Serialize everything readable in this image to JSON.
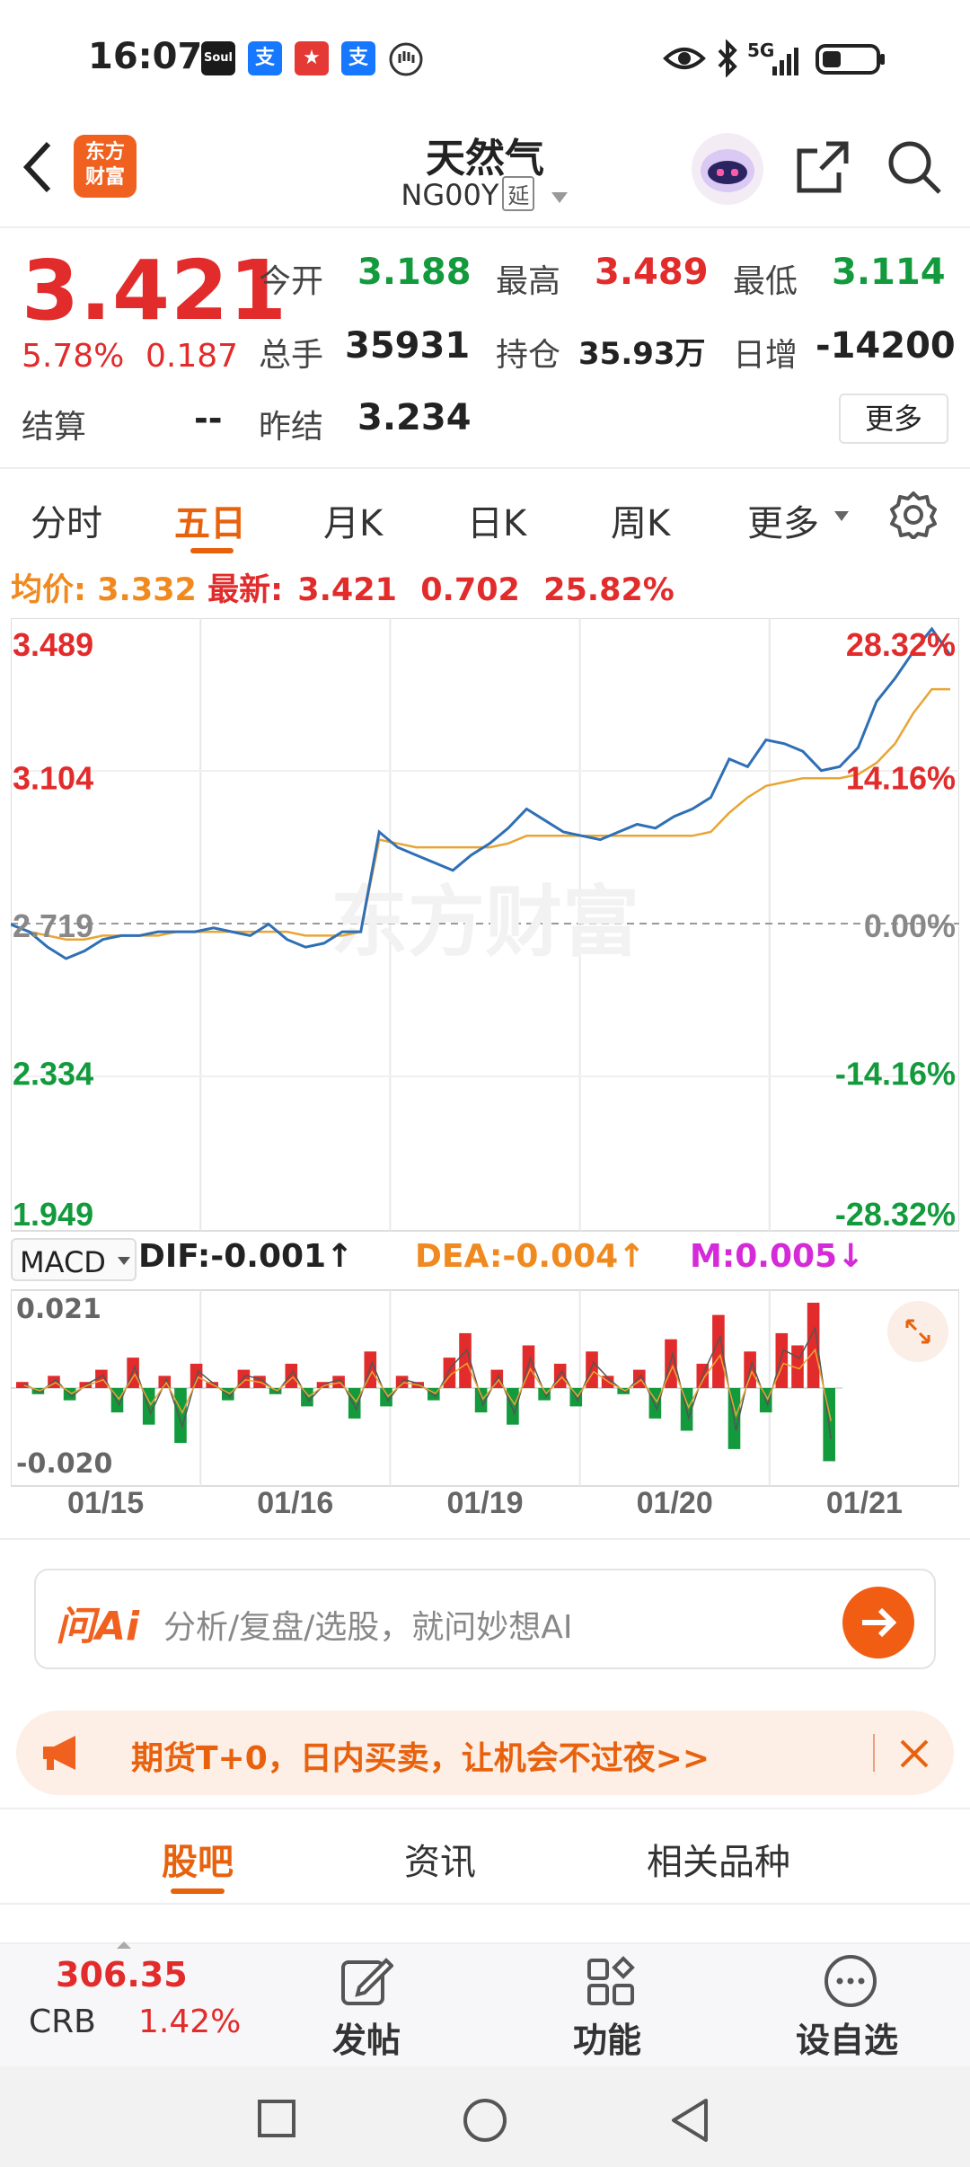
{
  "status_bar": {
    "time": "16:07",
    "apps": [
      {
        "name": "soul-app-icon",
        "text": "Soul",
        "color": "#1a1a1a"
      },
      {
        "name": "alipay-app-icon",
        "text": "支",
        "color": "#1677ff"
      },
      {
        "name": "red-app-icon",
        "text": "★",
        "color": "#e53935"
      },
      {
        "name": "alipay-app-icon-2",
        "text": "支",
        "color": "#1677ff"
      }
    ],
    "network": "5G"
  },
  "header": {
    "brand_text": "东方\n财富",
    "title": "天然气",
    "code": "NG00Y",
    "delay_badge": "延"
  },
  "quote": {
    "price": "3.421",
    "change_pct": "5.78%",
    "change_abs": "0.187",
    "open_label": "今开",
    "open": "3.188",
    "high_label": "最高",
    "high": "3.489",
    "low_label": "最低",
    "low": "3.114",
    "volume_label": "总手",
    "volume": "35931",
    "position_label": "持仓",
    "position": "35.93万",
    "daily_inc_label": "日增",
    "daily_inc": "-14200",
    "settle_label": "结算",
    "settle": "--",
    "prev_settle_label": "昨结",
    "prev_settle": "3.234",
    "more_button": "更多"
  },
  "tabs": [
    {
      "label": "分时",
      "active": false
    },
    {
      "label": "五日",
      "active": true
    },
    {
      "label": "月K",
      "active": false
    },
    {
      "label": "日K",
      "active": false
    },
    {
      "label": "周K",
      "active": false
    },
    {
      "label": "更多",
      "active": false
    }
  ],
  "avg_row": {
    "avg_label": "均价:",
    "avg_value": "3.332",
    "latest_label": "最新:",
    "latest_value": "3.421",
    "change": "0.702",
    "change_pct": "25.82%"
  },
  "watermark": "东方财富",
  "chart_data": {
    "type": "line",
    "y_left_ticks": [
      "3.489",
      "3.104",
      "2.719",
      "2.334",
      "1.949"
    ],
    "y_right_ticks": [
      "28.32%",
      "14.16%",
      "0.00%",
      "-14.16%",
      "-28.32%"
    ],
    "ylim": [
      1.949,
      3.489
    ],
    "base": 2.719,
    "x_labels": [
      "01/15",
      "01/16",
      "01/19",
      "01/20",
      "01/21"
    ],
    "series": [
      {
        "values": [
          2.719,
          2.7,
          2.66,
          2.63,
          2.65,
          2.68,
          2.69,
          2.69,
          2.7,
          2.7,
          2.7,
          2.71,
          2.7,
          2.69,
          2.72,
          2.68,
          2.66,
          2.67,
          2.7,
          2.7,
          2.96,
          2.92,
          2.9,
          2.88,
          2.86,
          2.9,
          2.93,
          2.97,
          3.02,
          2.99,
          2.96,
          2.95,
          2.94,
          2.96,
          2.98,
          2.97,
          3.0,
          3.02,
          3.05,
          3.15,
          3.13,
          3.2,
          3.19,
          3.17,
          3.12,
          3.13,
          3.18,
          3.3,
          3.36,
          3.43,
          3.489,
          3.421
        ]
      },
      {
        "values": [
          2.719,
          2.7,
          2.69,
          2.68,
          2.68,
          2.69,
          2.69,
          2.69,
          2.69,
          2.7,
          2.7,
          2.7,
          2.7,
          2.7,
          2.7,
          2.7,
          2.69,
          2.69,
          2.69,
          2.7,
          2.94,
          2.93,
          2.92,
          2.92,
          2.92,
          2.92,
          2.92,
          2.93,
          2.95,
          2.95,
          2.95,
          2.95,
          2.95,
          2.95,
          2.95,
          2.95,
          2.95,
          2.95,
          2.96,
          3.01,
          3.05,
          3.08,
          3.09,
          3.1,
          3.1,
          3.1,
          3.11,
          3.14,
          3.19,
          3.27,
          3.332,
          3.332
        ]
      }
    ]
  },
  "macd": {
    "selector": "MACD",
    "dif": "DIF:-0.001",
    "dea": "DEA:-0.004",
    "m": "M:0.005",
    "y_top": "0.021",
    "y_bottom": "-0.020",
    "bars": [
      1,
      -1,
      2,
      -2,
      1,
      3,
      -4,
      5,
      -6,
      2,
      -9,
      4,
      1,
      -2,
      3,
      2,
      -1,
      4,
      -3,
      1,
      2,
      -5,
      6,
      -3,
      2,
      1,
      -2,
      5,
      9,
      -4,
      3,
      -6,
      7,
      -2,
      4,
      -3,
      6,
      2,
      -1,
      3,
      -5,
      8,
      -7,
      4,
      12,
      -10,
      6,
      -4,
      9,
      7,
      14,
      -12
    ]
  },
  "ai_box": {
    "placeholder": "分析/复盘/选股，就问妙想AI",
    "logo": "问Ai"
  },
  "promo": {
    "text": "期货T+0，日内买卖，让机会不过夜>>"
  },
  "bottom_tabs": [
    {
      "label": "股吧",
      "active": true
    },
    {
      "label": "资讯",
      "active": false
    },
    {
      "label": "相关品种",
      "active": false
    }
  ],
  "toolbar": {
    "crb_value": "306.35",
    "crb_label": "CRB",
    "crb_change": "1.42%",
    "post_label": "发帖",
    "function_label": "功能",
    "watchlist_label": "设自选"
  }
}
